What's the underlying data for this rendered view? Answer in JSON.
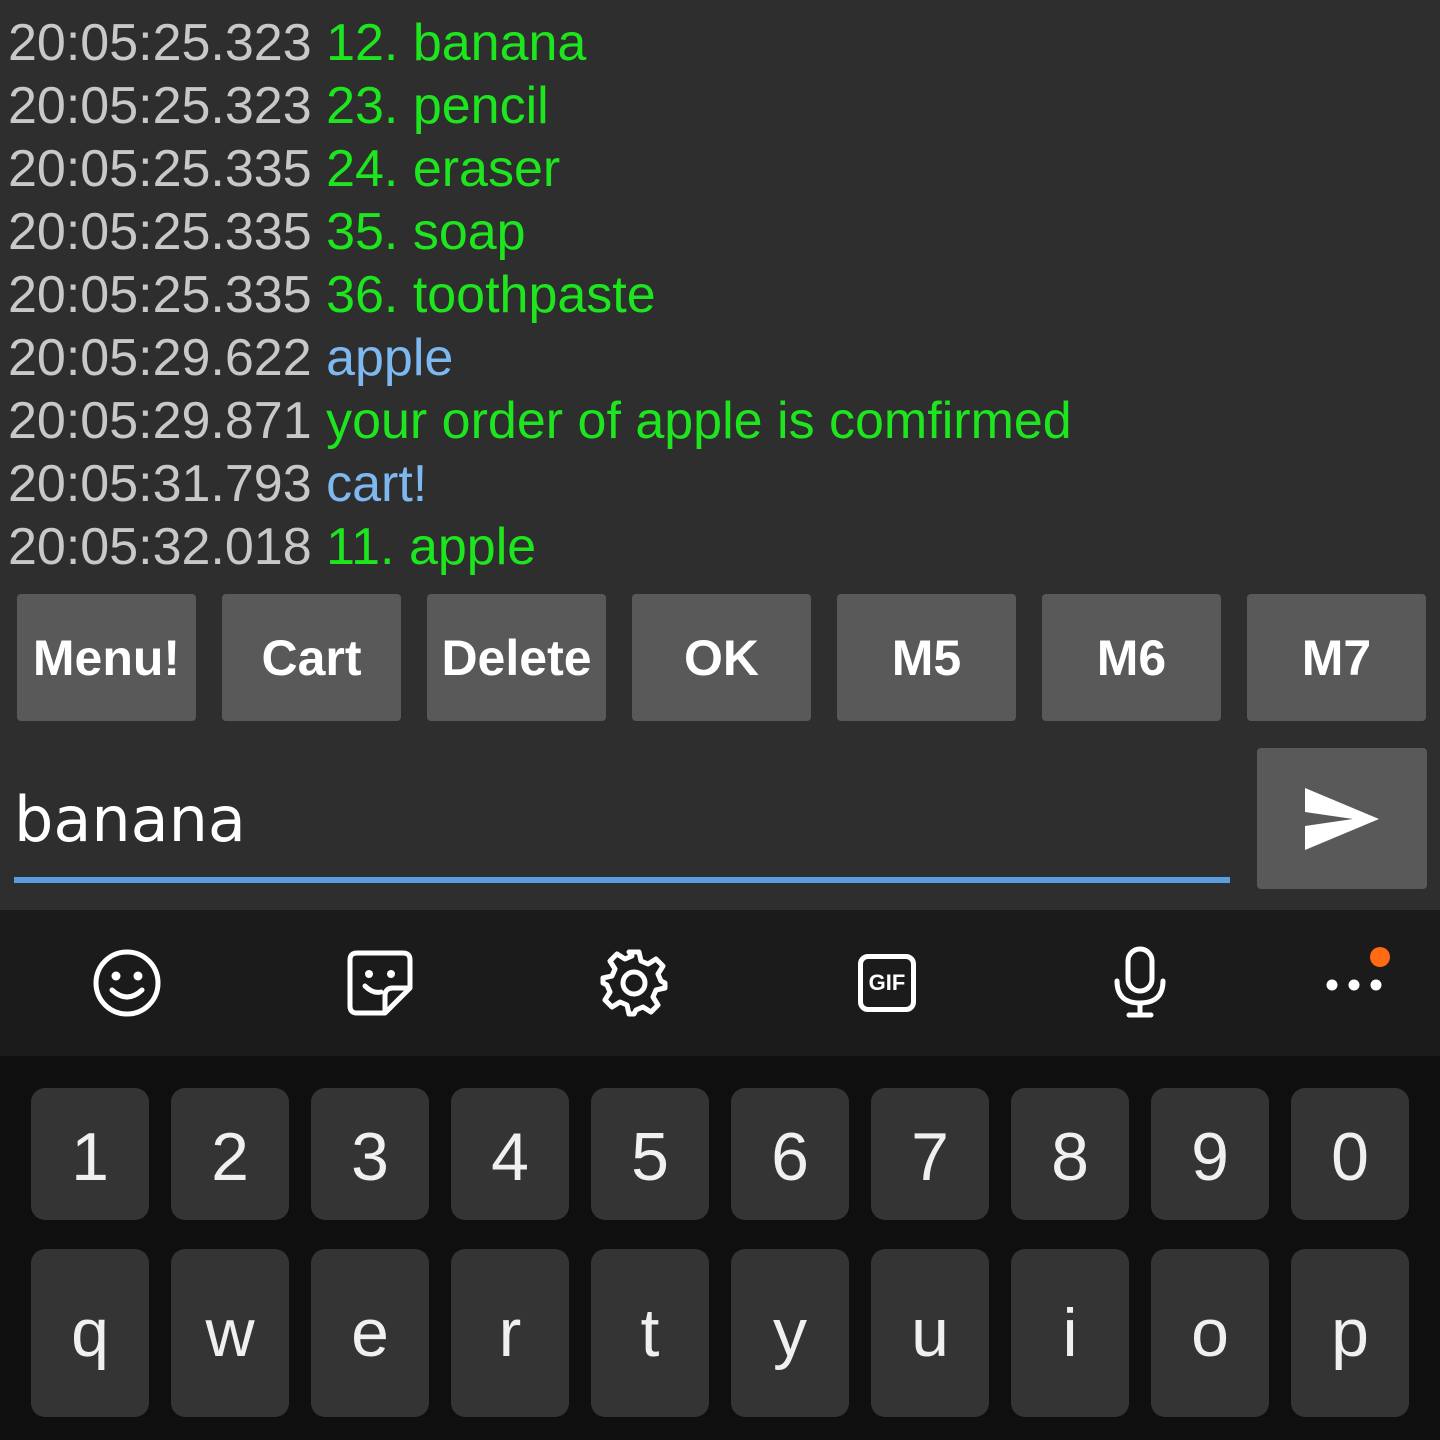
{
  "log": [
    {
      "time": "20:05:25.323",
      "text": "12. banana",
      "kind": "rx"
    },
    {
      "time": "20:05:25.323",
      "text": "23. pencil",
      "kind": "rx"
    },
    {
      "time": "20:05:25.335",
      "text": "24. eraser",
      "kind": "rx"
    },
    {
      "time": "20:05:25.335",
      "text": "35. soap",
      "kind": "rx"
    },
    {
      "time": "20:05:25.335",
      "text": "36. toothpaste",
      "kind": "rx"
    },
    {
      "time": "20:05:29.622",
      "text": "apple",
      "kind": "tx"
    },
    {
      "time": "20:05:29.871",
      "text": "your order of apple is comfirmed",
      "kind": "rx"
    },
    {
      "time": "20:05:31.793",
      "text": "cart!",
      "kind": "tx"
    },
    {
      "time": "20:05:32.018",
      "text": "11. apple",
      "kind": "rx"
    }
  ],
  "macros": [
    "Menu!",
    "Cart",
    "Delete",
    "OK",
    "M5",
    "M6",
    "M7"
  ],
  "input": {
    "value": "banana"
  },
  "toolbar": {
    "gif_label": "GIF",
    "icons": [
      "emoji-icon",
      "sticker-icon",
      "settings-icon",
      "gif-icon",
      "microphone-icon",
      "more-icon"
    ]
  },
  "keyboard": {
    "numbers": [
      "1",
      "2",
      "3",
      "4",
      "5",
      "6",
      "7",
      "8",
      "9",
      "0"
    ],
    "letters": [
      "q",
      "w",
      "e",
      "r",
      "t",
      "y",
      "u",
      "i",
      "o",
      "p"
    ]
  },
  "colors": {
    "received_text": "#1ee61e",
    "sent_text": "#7db8f0",
    "timestamp": "#c8c8c8",
    "accent_underline": "#5b9ddf",
    "notification_dot": "#ff6a13"
  }
}
